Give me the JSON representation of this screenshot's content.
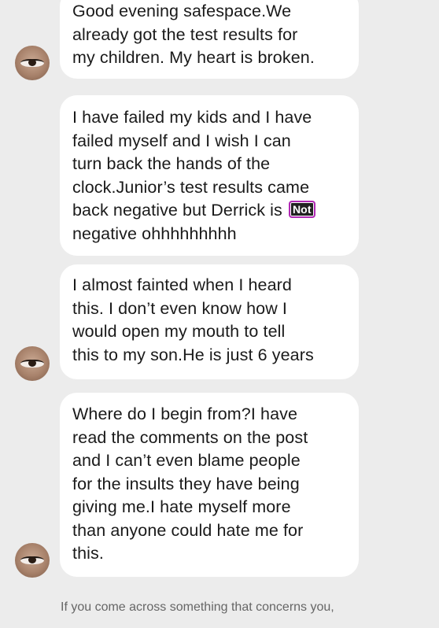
{
  "messages": [
    {
      "lines": [
        "Good evening safespace.We",
        "already got the test results for",
        "my children. My heart is broken."
      ]
    },
    {
      "lines": [
        "I have failed my kids and I have",
        "failed myself and I wish I can",
        "turn back the hands of the",
        "clock.Junior’s test results came",
        "back negative but Derrick is",
        "negative ohhhhhhhhh"
      ],
      "sticker": "Not"
    },
    {
      "lines": [
        "I almost fainted when I heard",
        "this. I don’t even know how I",
        "would open my mouth to tell",
        "this to my son.He is just 6 years"
      ]
    },
    {
      "lines": [
        "Where do I begin from?I have",
        "read the comments on the post",
        "and I can’t even blame people",
        "for the insults they have being",
        "giving me.I hate myself more",
        "than anyone could hate me for",
        "this."
      ]
    }
  ],
  "footer": "If you come across something that concerns you,"
}
